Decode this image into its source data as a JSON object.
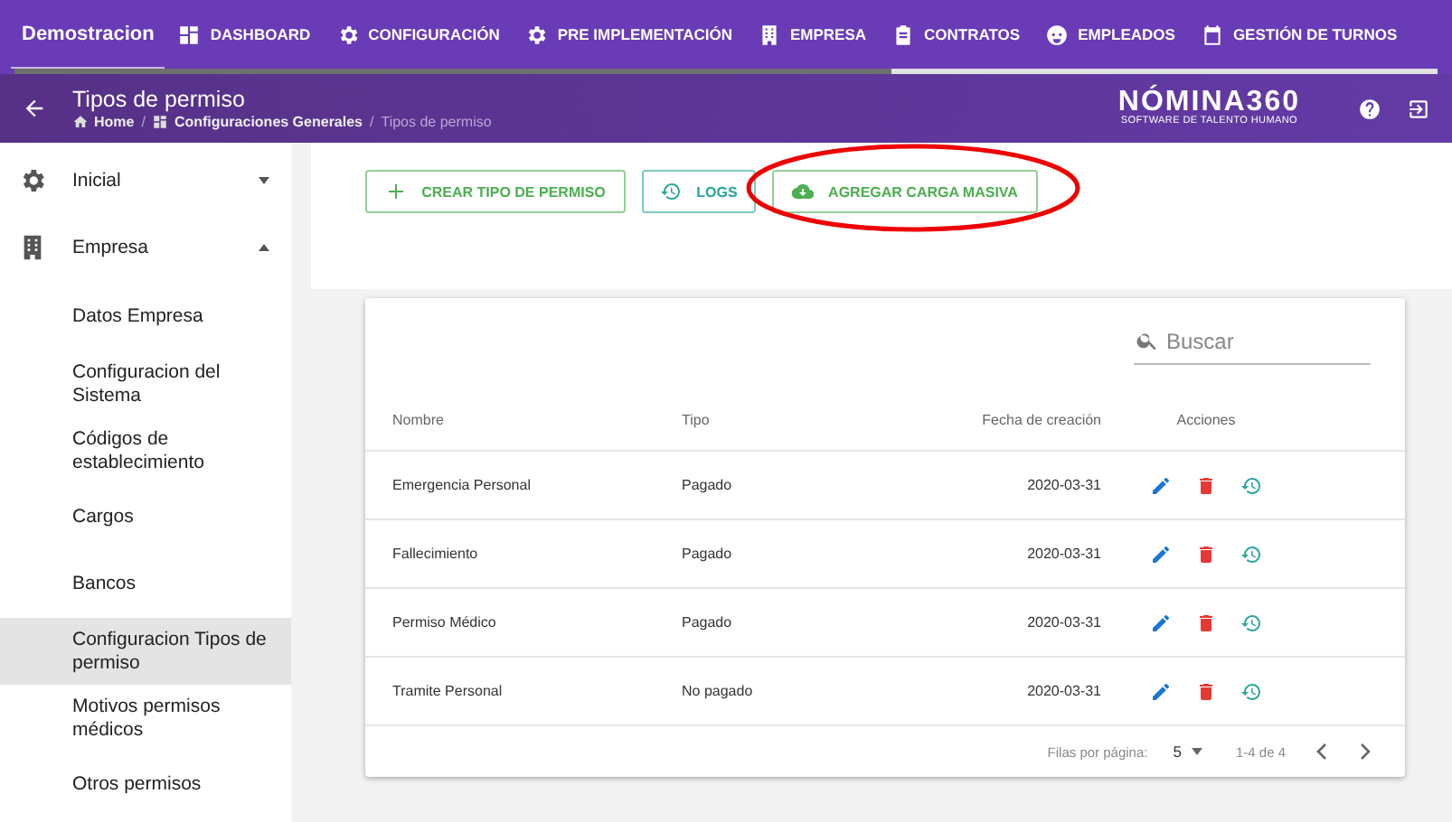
{
  "top_nav": {
    "brand": {
      "label": "Demostracion",
      "selected": true
    },
    "items": [
      {
        "label": "DASHBOARD",
        "kind": "grid",
        "selected": false
      },
      {
        "label": "CONFIGURACIÓN",
        "kind": "gear",
        "selected": false
      },
      {
        "label": "PRE IMPLEMENTACIÓN",
        "kind": "gear",
        "selected": false
      },
      {
        "label": "EMPRESA",
        "kind": "building",
        "selected": false
      },
      {
        "label": "CONTRATOS",
        "kind": "clipboard",
        "selected": false
      },
      {
        "label": "EMPLEADOS",
        "kind": "face",
        "selected": false
      },
      {
        "label": "GESTIÓN DE TURNOS",
        "kind": "calendar",
        "selected": false
      }
    ]
  },
  "header": {
    "title": "Tipos de permiso",
    "breadcrumbs": [
      {
        "label": "Home",
        "kind": "home"
      },
      {
        "label": "Configuraciones Generales",
        "kind": "grid",
        "separator": "/"
      },
      {
        "label": "Tipos de permiso",
        "kind": "plain",
        "separator": "/"
      }
    ],
    "logo": {
      "name": "NÓMINA360",
      "tagline": "SOFTWARE DE TALENTO HUMANO"
    }
  },
  "sidebar": {
    "items": [
      {
        "label": "Inicial",
        "kind": "gear",
        "expanded": false
      },
      {
        "label": "Empresa",
        "kind": "building",
        "expanded": true,
        "children": [
          {
            "label": "Datos Empresa",
            "selected": false
          },
          {
            "label": "Configuracion del Sistema",
            "selected": false
          },
          {
            "label": "Códigos de establecimiento",
            "selected": false
          },
          {
            "label": "Cargos",
            "selected": false
          },
          {
            "label": "Bancos",
            "selected": false
          },
          {
            "label": "Configuracion Tipos de permiso",
            "selected": true
          },
          {
            "label": "Motivos permisos médicos",
            "selected": false
          },
          {
            "label": "Otros permisos",
            "selected": false
          }
        ]
      }
    ]
  },
  "toolbar": [
    {
      "label": "CREAR TIPO DE PERMISO",
      "kind": "plus",
      "color": "#4caf50"
    },
    {
      "label": "LOGS",
      "kind": "history",
      "color": "#26a69a"
    },
    {
      "label": "AGREGAR CARGA MASIVA",
      "kind": "cloud",
      "color": "#4caf50"
    }
  ],
  "table": {
    "search": {
      "placeholder": "Buscar"
    },
    "columns": [
      "Nombre",
      "Tipo",
      "Fecha de creación",
      "Acciones"
    ],
    "rows": [
      {
        "cells": [
          "Emergencia Personal",
          "Pagado",
          "2020-03-31"
        ]
      },
      {
        "cells": [
          "Fallecimiento",
          "Pagado",
          "2020-03-31"
        ]
      },
      {
        "cells": [
          "Permiso Médico",
          "Pagado",
          "2020-03-31"
        ]
      },
      {
        "cells": [
          "Tramite Personal",
          "No pagado",
          "2020-03-31"
        ]
      }
    ],
    "pagination": {
      "rows_label": "Filas por página:",
      "rows_value": "5",
      "range": "1-4 de 4"
    }
  }
}
